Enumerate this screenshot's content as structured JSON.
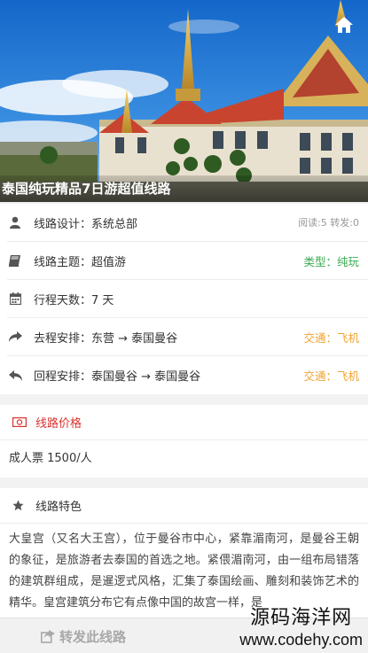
{
  "hero": {
    "title": "泰国纯玩精品7日游超值线路",
    "home_icon": "home-icon"
  },
  "info": [
    {
      "icon": "user-icon",
      "label": "线路设计：",
      "value": "系统总部",
      "right": "阅读:5 转发:0"
    },
    {
      "icon": "book-icon",
      "label": "线路主题：",
      "value": "超值游",
      "right": "类型：纯玩"
    },
    {
      "icon": "calendar-icon",
      "label": "行程天数：",
      "value": "7 天",
      "right": ""
    },
    {
      "icon": "share-forward-icon",
      "label": "去程安排：",
      "value": "东营 → 泰国曼谷",
      "right": "交通：飞机"
    },
    {
      "icon": "reply-icon",
      "label": "回程安排：",
      "value": "泰国曼谷 → 泰国曼谷",
      "right": "交通：飞机"
    }
  ],
  "price": {
    "title": "线路价格",
    "text": "成人票 1500/人"
  },
  "feature": {
    "title": "线路特色",
    "text": "大皇宫（又名大王宫），位于曼谷市中心，紧靠湄南河，是曼谷王朝的象征，是旅游者去泰国的首选之地。紧偎湄南河，由一组布局错落的建筑群组成，是暹逻式风格，汇集了泰国绘画、雕刻和装饰艺术的精华。皇宫建筑分布它有点像中国的故宫一样，是"
  },
  "bottom": {
    "share_label": "转发此线路"
  },
  "watermark": {
    "line1": "源码海洋网",
    "line2": "www.codehy.com"
  },
  "colors": {
    "accent_green": "#3bab52",
    "accent_orange": "#f0a330",
    "price_red": "#d9322e"
  }
}
